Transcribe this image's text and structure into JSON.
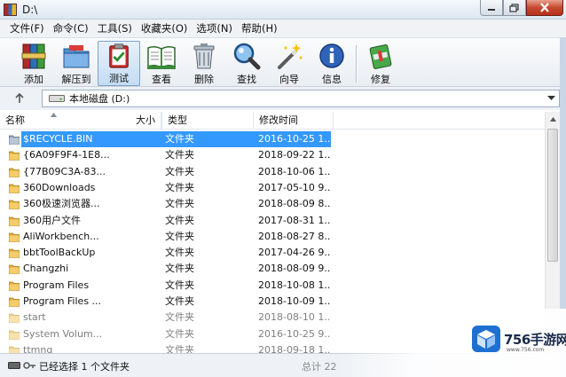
{
  "window": {
    "title": "D:\\"
  },
  "menu": [
    "文件(F)",
    "命令(C)",
    "工具(S)",
    "收藏夹(O)",
    "选项(N)",
    "帮助(H)"
  ],
  "toolbar": {
    "add": "添加",
    "extract": "解压到",
    "test": "测试",
    "view": "查看",
    "delete": "删除",
    "find": "查找",
    "wizard": "向导",
    "info": "信息",
    "repair": "修复"
  },
  "address": {
    "path": "本地磁盘 (D:)"
  },
  "columns": {
    "name": "名称",
    "size": "大小",
    "type": "类型",
    "modified": "修改时间"
  },
  "files": [
    {
      "name": "$RECYCLE.BIN",
      "type": "文件夹",
      "modified": "2016-10-25 1..."
    },
    {
      "name": "{6A09F9F4-1E8...",
      "type": "文件夹",
      "modified": "2018-09-22 1..."
    },
    {
      "name": "{77B09C3A-83...",
      "type": "文件夹",
      "modified": "2018-10-06 1..."
    },
    {
      "name": "360Downloads",
      "type": "文件夹",
      "modified": "2017-05-10 9..."
    },
    {
      "name": "360极速浏览器...",
      "type": "文件夹",
      "modified": "2018-08-09 8..."
    },
    {
      "name": "360用户文件",
      "type": "文件夹",
      "modified": "2017-08-31 1..."
    },
    {
      "name": "AliWorkbench...",
      "type": "文件夹",
      "modified": "2018-08-27 8..."
    },
    {
      "name": "bbtToolBackUp",
      "type": "文件夹",
      "modified": "2017-04-26 9..."
    },
    {
      "name": "Changzhi",
      "type": "文件夹",
      "modified": "2018-08-09 9..."
    },
    {
      "name": "Program Files",
      "type": "文件夹",
      "modified": "2018-10-08 1..."
    },
    {
      "name": "Program Files ...",
      "type": "文件夹",
      "modified": "2018-10-09 1..."
    },
    {
      "name": "start",
      "type": "文件夹",
      "modified": "2018-08-10 1..."
    },
    {
      "name": "System Volum...",
      "type": "文件夹",
      "modified": "2016-10-25 9..."
    },
    {
      "name": "ttmng",
      "type": "文件夹",
      "modified": "2018-09-18 1..."
    }
  ],
  "status": {
    "selected": "已经选择 1 个文件夹",
    "total": "总计 22"
  },
  "watermark": {
    "brand": "756手游网",
    "url": "www.756.com"
  },
  "colors": {
    "selection": "#3399ff",
    "folder": "#e8b640",
    "close": "#c54930"
  }
}
